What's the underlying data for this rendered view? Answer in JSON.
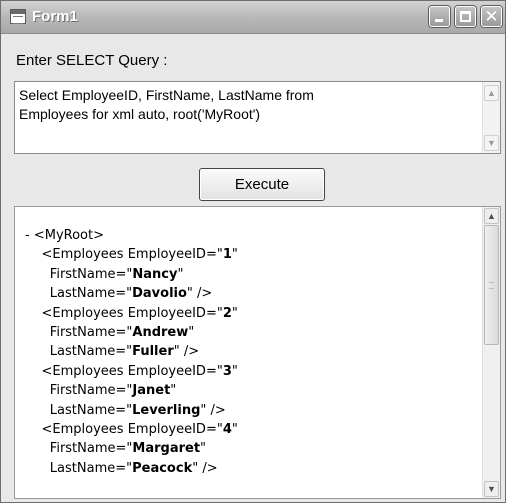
{
  "window": {
    "title": "Form1",
    "controls": {
      "minimize_icon": "minimize-icon",
      "maximize_icon": "maximize-icon",
      "close_icon": "close-icon"
    }
  },
  "query": {
    "label": "Enter SELECT Query :",
    "value": "Select EmployeeID, FirstName, LastName from\nEmployees for xml auto, root('MyRoot')"
  },
  "execute_label": "Execute",
  "xml": {
    "collapse_symbol": "-",
    "root_open": "<MyRoot>",
    "employees": [
      {
        "id": "1",
        "first": "Nancy",
        "last": "Davolio"
      },
      {
        "id": "2",
        "first": "Andrew",
        "last": "Fuller"
      },
      {
        "id": "3",
        "first": "Janet",
        "last": "Leverling"
      },
      {
        "id": "4",
        "first": "Margaret",
        "last": "Peacock"
      }
    ]
  },
  "colors": {
    "titlebar": "#b8b8b8",
    "window_bg": "#e8e8e8"
  }
}
